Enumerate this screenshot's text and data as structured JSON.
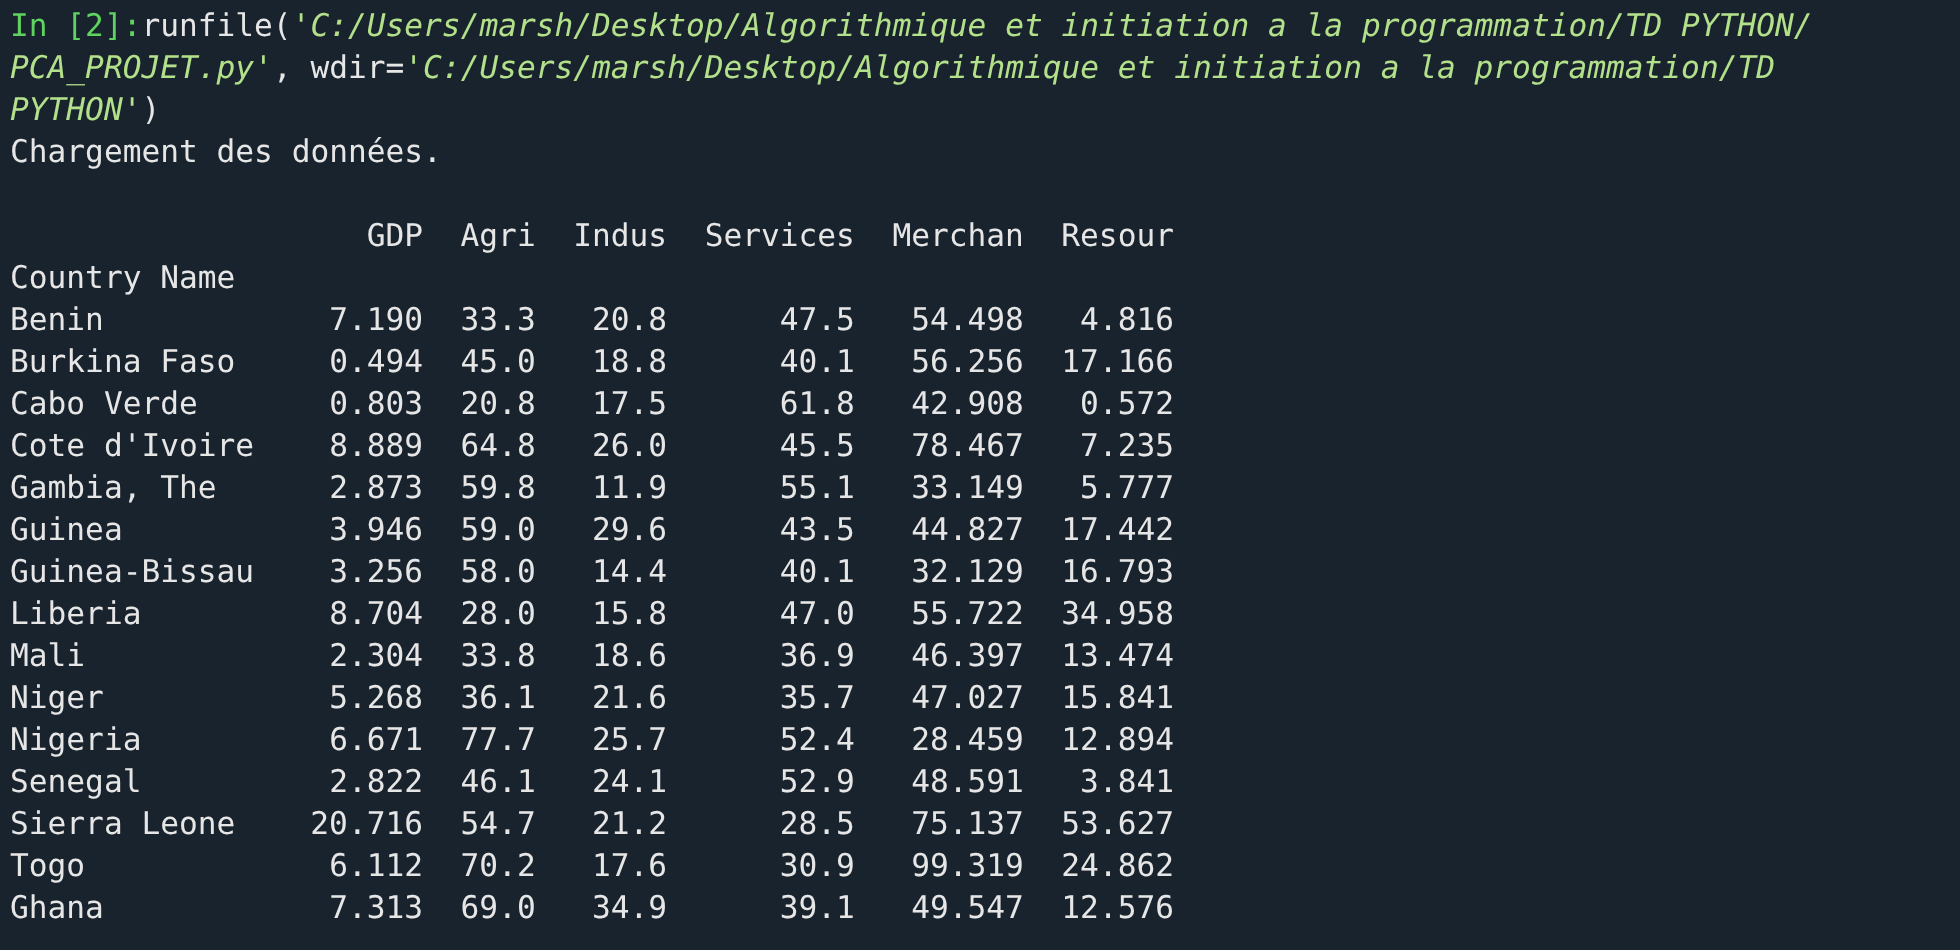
{
  "prompt": "In [2]:",
  "command_lines": [
    [
      {
        "kind": "code",
        "text": "runfile("
      },
      {
        "kind": "string",
        "text": "'C:/Users/marsh/Desktop/Algorithmique et initiation a la programmation/TD PYTHON/"
      }
    ],
    [
      {
        "kind": "string",
        "text": "PCA_PROJET.py'"
      },
      {
        "kind": "code",
        "text": ", wdir="
      },
      {
        "kind": "string",
        "text": "'C:/Users/marsh/Desktop/Algorithmique et initiation a la programmation/TD"
      }
    ],
    [
      {
        "kind": "string",
        "text": "PYTHON'"
      },
      {
        "kind": "code",
        "text": ")"
      }
    ]
  ],
  "output_message": "Chargement des données.",
  "table": {
    "columns": [
      "GDP",
      "Agri",
      "Indus",
      "Services",
      "Merchan",
      "Resour"
    ],
    "index_name": "Country Name",
    "rows": [
      {
        "name": "Benin",
        "values": [
          "7.190",
          "33.3",
          "20.8",
          "47.5",
          "54.498",
          "4.816"
        ]
      },
      {
        "name": "Burkina Faso",
        "values": [
          "0.494",
          "45.0",
          "18.8",
          "40.1",
          "56.256",
          "17.166"
        ]
      },
      {
        "name": "Cabo Verde",
        "values": [
          "0.803",
          "20.8",
          "17.5",
          "61.8",
          "42.908",
          "0.572"
        ]
      },
      {
        "name": "Cote d'Ivoire",
        "values": [
          "8.889",
          "64.8",
          "26.0",
          "45.5",
          "78.467",
          "7.235"
        ]
      },
      {
        "name": "Gambia, The",
        "values": [
          "2.873",
          "59.8",
          "11.9",
          "55.1",
          "33.149",
          "5.777"
        ]
      },
      {
        "name": "Guinea",
        "values": [
          "3.946",
          "59.0",
          "29.6",
          "43.5",
          "44.827",
          "17.442"
        ]
      },
      {
        "name": "Guinea-Bissau",
        "values": [
          "3.256",
          "58.0",
          "14.4",
          "40.1",
          "32.129",
          "16.793"
        ]
      },
      {
        "name": "Liberia",
        "values": [
          "8.704",
          "28.0",
          "15.8",
          "47.0",
          "55.722",
          "34.958"
        ]
      },
      {
        "name": "Mali",
        "values": [
          "2.304",
          "33.8",
          "18.6",
          "36.9",
          "46.397",
          "13.474"
        ]
      },
      {
        "name": "Niger",
        "values": [
          "5.268",
          "36.1",
          "21.6",
          "35.7",
          "47.027",
          "15.841"
        ]
      },
      {
        "name": "Nigeria",
        "values": [
          "6.671",
          "77.7",
          "25.7",
          "52.4",
          "28.459",
          "12.894"
        ]
      },
      {
        "name": "Senegal",
        "values": [
          "2.822",
          "46.1",
          "24.1",
          "52.9",
          "48.591",
          "3.841"
        ]
      },
      {
        "name": "Sierra Leone",
        "values": [
          "20.716",
          "54.7",
          "21.2",
          "28.5",
          "75.137",
          "53.627"
        ]
      },
      {
        "name": "Togo",
        "values": [
          "6.112",
          "70.2",
          "17.6",
          "30.9",
          "99.319",
          "24.862"
        ]
      },
      {
        "name": "Ghana",
        "values": [
          "7.313",
          "69.0",
          "34.9",
          "39.1",
          "49.547",
          "12.576"
        ]
      }
    ]
  }
}
